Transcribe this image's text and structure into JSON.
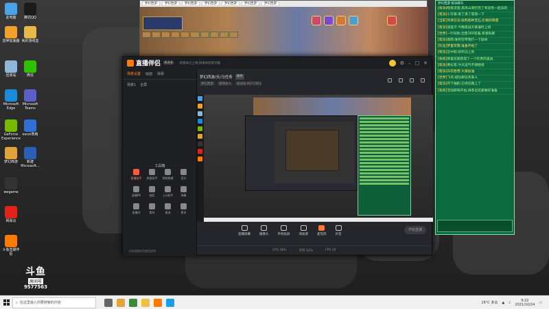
{
  "desktop": {
    "icons": [
      {
        "label": "此电脑",
        "color": "#4aa3e8"
      },
      {
        "label": "腾讯QQ",
        "color": "#1a1a1a"
      },
      {
        "label": "雷神加速器",
        "color": "#f1a12a"
      },
      {
        "label": "我的游戏盒",
        "color": "#e8b84a"
      },
      {
        "label": "回收站",
        "color": "#8fb7da"
      },
      {
        "label": "微信",
        "color": "#2dc100"
      },
      {
        "label": "Microsoft Edge",
        "color": "#1a8bd8"
      },
      {
        "label": "Microsoft Teams",
        "color": "#5b5fc7"
      },
      {
        "label": "GeForce Experience",
        "color": "#76b900"
      },
      {
        "label": "excel表格",
        "color": "#2f6fd6"
      },
      {
        "label": "梦幻西游",
        "color": "#e0a43a"
      },
      {
        "label": "新建 Microsoft...",
        "color": "#2b5fb3"
      },
      {
        "label": "wegame",
        "color": "#333333"
      },
      {
        "label": "网易云",
        "color": "#e2231a"
      },
      {
        "label": "斗鱼直播伴侣",
        "color": "#ff7a00"
      }
    ]
  },
  "game_window": {
    "tabs": [
      "梦幻西游",
      "梦幻西游",
      "梦幻西游",
      "梦幻西游",
      "梦幻西游",
      "梦幻西游",
      "梦幻西游"
    ]
  },
  "streaming_app": {
    "logo": "直播伴侣",
    "version": "6.3.0",
    "announcement": "新版本已上线,快来体验新功能",
    "left_tabs": [
      "场景设置",
      "画面",
      "弹幕"
    ],
    "scene_row": [
      "场景1",
      "全屏"
    ],
    "tools_title": "工具箱",
    "tools": [
      {
        "label": "直播助手",
        "hot": true
      },
      {
        "label": "房管助手",
        "hot": false
      },
      {
        "label": "视频剪辑",
        "hot": false
      },
      {
        "label": "音乐",
        "hot": false
      },
      {
        "label": "直播PK",
        "hot": false
      },
      {
        "label": "抽奖",
        "hot": false
      },
      {
        "label": "上分助手",
        "hot": false
      },
      {
        "label": "弹幕",
        "hot": false
      },
      {
        "label": "直播间",
        "hot": false
      },
      {
        "label": "素材",
        "hot": false
      },
      {
        "label": "推流",
        "hot": false
      },
      {
        "label": "更多",
        "hot": false
      }
    ],
    "bottom_note": "斗鱼直播伴侣使用说明",
    "room_title": "梦幻西游/天/马任务",
    "room_tag": "修改",
    "room_info": [
      "梦幻西游",
      "游戏达人",
      "房间号 9577563"
    ],
    "bottom_buttons": [
      "直播屏幕",
      "摄像头",
      "手机投屏",
      "添加源",
      "麦克风",
      "声音"
    ],
    "start_button": "开始直播",
    "status": [
      "CPU 38%",
      "内存 62%",
      "FPS 30"
    ]
  },
  "chat": {
    "title": "梦幻西游 帮派聊天",
    "messages": [
      {
        "name": "[帮派]",
        "text": "暗夜流萤:黑风山洞打完了有没有一起去的"
      },
      {
        "name": "[帮派]",
        "text": "小可爱:来了来了等我一下"
      },
      {
        "name": "[当前]",
        "text": "风清云淡:收购各种宝石,价格好商量"
      },
      {
        "name": "[帮派]",
        "text": "逍遥子:今晚帮战大家准时上线"
      },
      {
        "name": "[世界]",
        "text": "一叶知秋:出售160装备,有意私聊"
      },
      {
        "name": "[帮派]",
        "text": "夜雨:谁有空带我打一下副本"
      },
      {
        "name": "[队伍]",
        "text": "梦里花落:准备开始了"
      },
      {
        "name": "[帮派]",
        "text": "云中鹤:好的马上到"
      },
      {
        "name": "[系统]",
        "text": "恭喜玩家获得了一个珍贵的道具"
      },
      {
        "name": "[帮派]",
        "text": "青衫客:今天运气不错哈哈"
      },
      {
        "name": "[帮派]",
        "text": "白衣胜雪:大家加油"
      },
      {
        "name": "[世界]",
        "text": "飞鸟:组队刷任务来人"
      },
      {
        "name": "[帮派]",
        "text": "月下独酌:已经在路上了"
      },
      {
        "name": "[系统]",
        "text": "活动即将开始,请各位玩家做好准备"
      }
    ]
  },
  "watermark": {
    "brand": "斗鱼",
    "label": "房间号",
    "room": "9577563"
  },
  "taskbar": {
    "search_placeholder": "在这里输入你要搜索的内容",
    "weather": "16°C 多云",
    "time": "9:22",
    "date": "2021/10/24"
  }
}
